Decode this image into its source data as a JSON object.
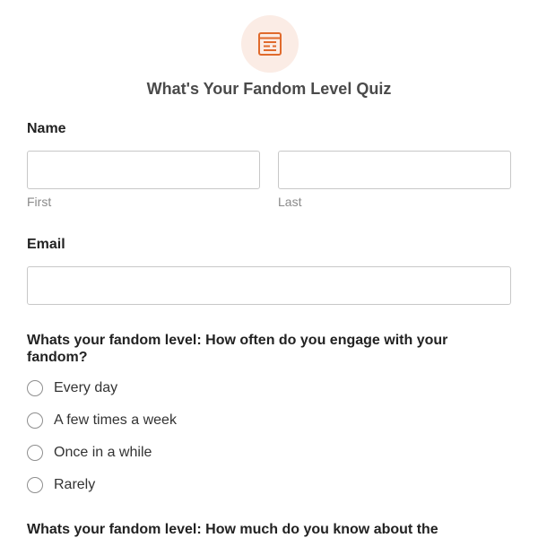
{
  "form": {
    "title": "What's Your Fandom Level Quiz",
    "icon": "form-list-icon",
    "accent_color": "#e06a2c",
    "icon_background": "#fbece5"
  },
  "name_field": {
    "label": "Name",
    "first": {
      "value": "",
      "sublabel": "First"
    },
    "last": {
      "value": "",
      "sublabel": "Last"
    }
  },
  "email_field": {
    "label": "Email",
    "value": ""
  },
  "question1": {
    "text": "Whats your fandom level: How often do you engage with your fandom?",
    "options": [
      "Every day",
      "A few times a week",
      "Once in a while",
      "Rarely"
    ]
  },
  "question2": {
    "text": "Whats your fandom level: How much do you know about the"
  }
}
